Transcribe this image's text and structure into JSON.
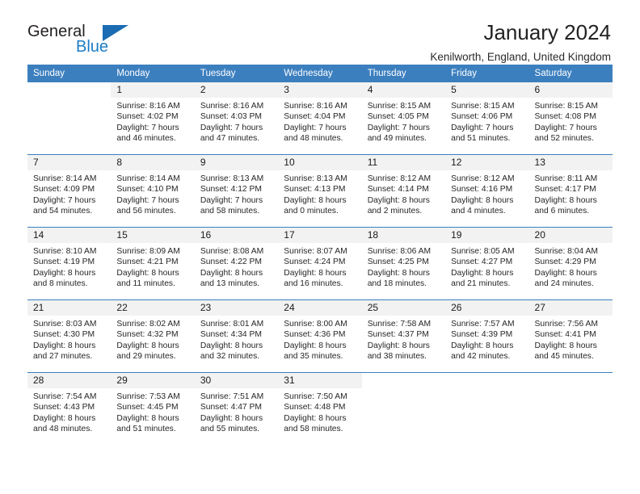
{
  "brand": {
    "name_top": "General",
    "name_bottom": "Blue",
    "accent_color": "#1b6cb3"
  },
  "header": {
    "title": "January 2024",
    "subtitle": "Kenilworth, England, United Kingdom"
  },
  "theme": {
    "header_row_bg": "#3c7fbf",
    "daynum_bg": "#f2f2f2",
    "text": "#262626"
  },
  "calendar": {
    "weekday_headers": [
      "Sunday",
      "Monday",
      "Tuesday",
      "Wednesday",
      "Thursday",
      "Friday",
      "Saturday"
    ],
    "weeks": [
      [
        {
          "day": "",
          "sunrise": "",
          "sunset": "",
          "daylight1": "",
          "daylight2": "",
          "blank": true
        },
        {
          "day": "1",
          "sunrise": "Sunrise: 8:16 AM",
          "sunset": "Sunset: 4:02 PM",
          "daylight1": "Daylight: 7 hours",
          "daylight2": "and 46 minutes."
        },
        {
          "day": "2",
          "sunrise": "Sunrise: 8:16 AM",
          "sunset": "Sunset: 4:03 PM",
          "daylight1": "Daylight: 7 hours",
          "daylight2": "and 47 minutes."
        },
        {
          "day": "3",
          "sunrise": "Sunrise: 8:16 AM",
          "sunset": "Sunset: 4:04 PM",
          "daylight1": "Daylight: 7 hours",
          "daylight2": "and 48 minutes."
        },
        {
          "day": "4",
          "sunrise": "Sunrise: 8:15 AM",
          "sunset": "Sunset: 4:05 PM",
          "daylight1": "Daylight: 7 hours",
          "daylight2": "and 49 minutes."
        },
        {
          "day": "5",
          "sunrise": "Sunrise: 8:15 AM",
          "sunset": "Sunset: 4:06 PM",
          "daylight1": "Daylight: 7 hours",
          "daylight2": "and 51 minutes."
        },
        {
          "day": "6",
          "sunrise": "Sunrise: 8:15 AM",
          "sunset": "Sunset: 4:08 PM",
          "daylight1": "Daylight: 7 hours",
          "daylight2": "and 52 minutes."
        }
      ],
      [
        {
          "day": "7",
          "sunrise": "Sunrise: 8:14 AM",
          "sunset": "Sunset: 4:09 PM",
          "daylight1": "Daylight: 7 hours",
          "daylight2": "and 54 minutes."
        },
        {
          "day": "8",
          "sunrise": "Sunrise: 8:14 AM",
          "sunset": "Sunset: 4:10 PM",
          "daylight1": "Daylight: 7 hours",
          "daylight2": "and 56 minutes."
        },
        {
          "day": "9",
          "sunrise": "Sunrise: 8:13 AM",
          "sunset": "Sunset: 4:12 PM",
          "daylight1": "Daylight: 7 hours",
          "daylight2": "and 58 minutes."
        },
        {
          "day": "10",
          "sunrise": "Sunrise: 8:13 AM",
          "sunset": "Sunset: 4:13 PM",
          "daylight1": "Daylight: 8 hours",
          "daylight2": "and 0 minutes."
        },
        {
          "day": "11",
          "sunrise": "Sunrise: 8:12 AM",
          "sunset": "Sunset: 4:14 PM",
          "daylight1": "Daylight: 8 hours",
          "daylight2": "and 2 minutes."
        },
        {
          "day": "12",
          "sunrise": "Sunrise: 8:12 AM",
          "sunset": "Sunset: 4:16 PM",
          "daylight1": "Daylight: 8 hours",
          "daylight2": "and 4 minutes."
        },
        {
          "day": "13",
          "sunrise": "Sunrise: 8:11 AM",
          "sunset": "Sunset: 4:17 PM",
          "daylight1": "Daylight: 8 hours",
          "daylight2": "and 6 minutes."
        }
      ],
      [
        {
          "day": "14",
          "sunrise": "Sunrise: 8:10 AM",
          "sunset": "Sunset: 4:19 PM",
          "daylight1": "Daylight: 8 hours",
          "daylight2": "and 8 minutes."
        },
        {
          "day": "15",
          "sunrise": "Sunrise: 8:09 AM",
          "sunset": "Sunset: 4:21 PM",
          "daylight1": "Daylight: 8 hours",
          "daylight2": "and 11 minutes."
        },
        {
          "day": "16",
          "sunrise": "Sunrise: 8:08 AM",
          "sunset": "Sunset: 4:22 PM",
          "daylight1": "Daylight: 8 hours",
          "daylight2": "and 13 minutes."
        },
        {
          "day": "17",
          "sunrise": "Sunrise: 8:07 AM",
          "sunset": "Sunset: 4:24 PM",
          "daylight1": "Daylight: 8 hours",
          "daylight2": "and 16 minutes."
        },
        {
          "day": "18",
          "sunrise": "Sunrise: 8:06 AM",
          "sunset": "Sunset: 4:25 PM",
          "daylight1": "Daylight: 8 hours",
          "daylight2": "and 18 minutes."
        },
        {
          "day": "19",
          "sunrise": "Sunrise: 8:05 AM",
          "sunset": "Sunset: 4:27 PM",
          "daylight1": "Daylight: 8 hours",
          "daylight2": "and 21 minutes."
        },
        {
          "day": "20",
          "sunrise": "Sunrise: 8:04 AM",
          "sunset": "Sunset: 4:29 PM",
          "daylight1": "Daylight: 8 hours",
          "daylight2": "and 24 minutes."
        }
      ],
      [
        {
          "day": "21",
          "sunrise": "Sunrise: 8:03 AM",
          "sunset": "Sunset: 4:30 PM",
          "daylight1": "Daylight: 8 hours",
          "daylight2": "and 27 minutes."
        },
        {
          "day": "22",
          "sunrise": "Sunrise: 8:02 AM",
          "sunset": "Sunset: 4:32 PM",
          "daylight1": "Daylight: 8 hours",
          "daylight2": "and 29 minutes."
        },
        {
          "day": "23",
          "sunrise": "Sunrise: 8:01 AM",
          "sunset": "Sunset: 4:34 PM",
          "daylight1": "Daylight: 8 hours",
          "daylight2": "and 32 minutes."
        },
        {
          "day": "24",
          "sunrise": "Sunrise: 8:00 AM",
          "sunset": "Sunset: 4:36 PM",
          "daylight1": "Daylight: 8 hours",
          "daylight2": "and 35 minutes."
        },
        {
          "day": "25",
          "sunrise": "Sunrise: 7:58 AM",
          "sunset": "Sunset: 4:37 PM",
          "daylight1": "Daylight: 8 hours",
          "daylight2": "and 38 minutes."
        },
        {
          "day": "26",
          "sunrise": "Sunrise: 7:57 AM",
          "sunset": "Sunset: 4:39 PM",
          "daylight1": "Daylight: 8 hours",
          "daylight2": "and 42 minutes."
        },
        {
          "day": "27",
          "sunrise": "Sunrise: 7:56 AM",
          "sunset": "Sunset: 4:41 PM",
          "daylight1": "Daylight: 8 hours",
          "daylight2": "and 45 minutes."
        }
      ],
      [
        {
          "day": "28",
          "sunrise": "Sunrise: 7:54 AM",
          "sunset": "Sunset: 4:43 PM",
          "daylight1": "Daylight: 8 hours",
          "daylight2": "and 48 minutes."
        },
        {
          "day": "29",
          "sunrise": "Sunrise: 7:53 AM",
          "sunset": "Sunset: 4:45 PM",
          "daylight1": "Daylight: 8 hours",
          "daylight2": "and 51 minutes."
        },
        {
          "day": "30",
          "sunrise": "Sunrise: 7:51 AM",
          "sunset": "Sunset: 4:47 PM",
          "daylight1": "Daylight: 8 hours",
          "daylight2": "and 55 minutes."
        },
        {
          "day": "31",
          "sunrise": "Sunrise: 7:50 AM",
          "sunset": "Sunset: 4:48 PM",
          "daylight1": "Daylight: 8 hours",
          "daylight2": "and 58 minutes."
        },
        {
          "day": "",
          "sunrise": "",
          "sunset": "",
          "daylight1": "",
          "daylight2": "",
          "blank": true
        },
        {
          "day": "",
          "sunrise": "",
          "sunset": "",
          "daylight1": "",
          "daylight2": "",
          "blank": true
        },
        {
          "day": "",
          "sunrise": "",
          "sunset": "",
          "daylight1": "",
          "daylight2": "",
          "blank": true
        }
      ]
    ]
  }
}
